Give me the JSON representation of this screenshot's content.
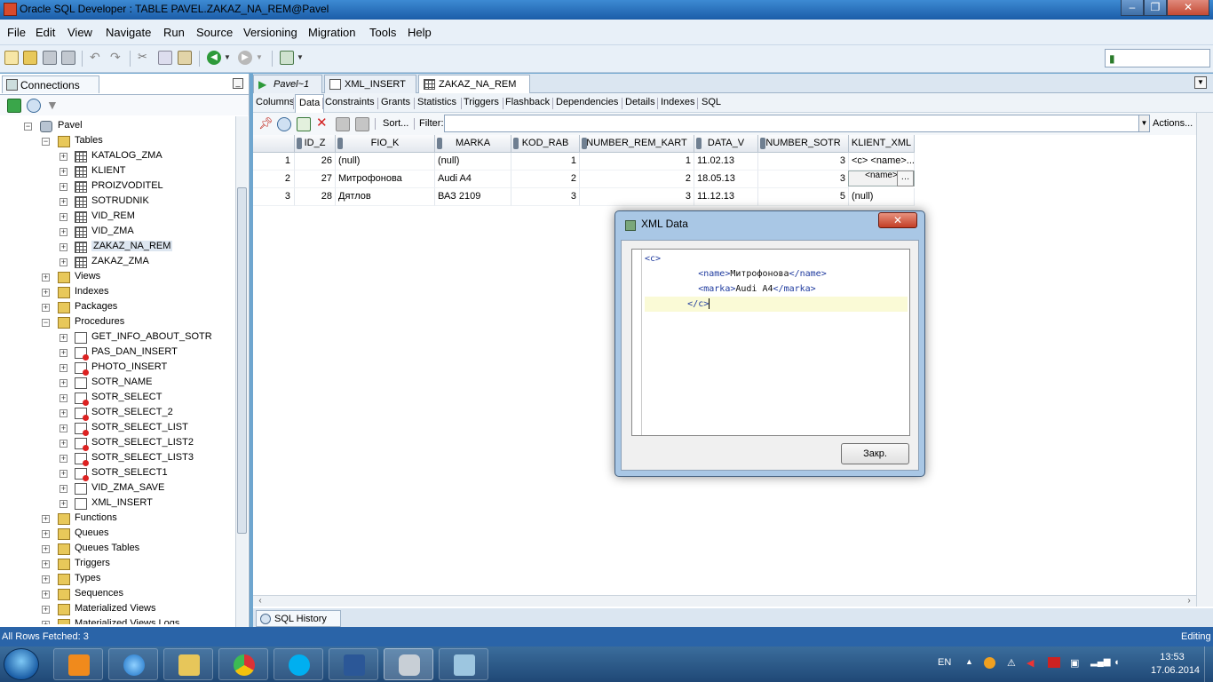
{
  "window": {
    "title": "Oracle SQL Developer : TABLE PAVEL.ZAKAZ_NA_REM@Pavel"
  },
  "menu": [
    "File",
    "Edit",
    "View",
    "Navigate",
    "Run",
    "Source",
    "Versioning",
    "Migration",
    "Tools",
    "Help"
  ],
  "connections_panel": {
    "tab_label": "Connections",
    "root": "Pavel",
    "tables_label": "Tables",
    "tables": [
      "KATALOG_ZMA",
      "KLIENT",
      "PROIZVODITEL",
      "SOTRUDNIK",
      "VID_REM",
      "VID_ZMA",
      "ZAKAZ_NA_REM",
      "ZAKAZ_ZMA"
    ],
    "groups_a": [
      "Views",
      "Indexes",
      "Packages"
    ],
    "procedures_label": "Procedures",
    "procedures": [
      "GET_INFO_ABOUT_SOTR",
      "PAS_DAN_INSERT",
      "PHOTO_INSERT",
      "SOTR_NAME",
      "SOTR_SELECT",
      "SOTR_SELECT_2",
      "SOTR_SELECT_LIST",
      "SOTR_SELECT_LIST2",
      "SOTR_SELECT_LIST3",
      "SOTR_SELECT1",
      "VID_ZMA_SAVE",
      "XML_INSERT"
    ],
    "groups_b": [
      "Functions",
      "Queues",
      "Queues Tables",
      "Triggers",
      "Types",
      "Sequences",
      "Materialized Views",
      "Materialized Views Logs"
    ]
  },
  "doc_tabs": [
    "Pavel~1",
    "XML_INSERT",
    "ZAKAZ_NA_REM"
  ],
  "sub_tabs": [
    "Columns",
    "Data",
    "Constraints",
    "Grants",
    "Statistics",
    "Triggers",
    "Flashback",
    "Dependencies",
    "Details",
    "Indexes",
    "SQL"
  ],
  "grid_toolbar": {
    "sort": "Sort...",
    "filter": "Filter:",
    "actions": "Actions..."
  },
  "grid": {
    "columns": [
      "ID_Z",
      "FIO_K",
      "MARKA",
      "KOD_RAB",
      "NUMBER_REM_KART",
      "DATA_V",
      "NUMBER_SOTR",
      "KLIENT_XML"
    ],
    "rows": [
      [
        "1",
        "26",
        "(null)",
        "(null)",
        "1",
        "1",
        "11.02.13",
        "3",
        "<c>  <name>..."
      ],
      [
        "2",
        "27",
        "Митрофонова",
        "Audi A4",
        "2",
        "2",
        "18.05.13",
        "3",
        "<name>"
      ],
      [
        "3",
        "28",
        "Дятлов",
        "ВАЗ 2109",
        "3",
        "3",
        "11.12.13",
        "5",
        "(null)"
      ]
    ]
  },
  "bottom_tab": "SQL History",
  "status": {
    "left": "All Rows Fetched: 3",
    "right": "Editing"
  },
  "dialog": {
    "title": "XML Data",
    "lines": [
      {
        "indent": "",
        "open": "<c>",
        "text": "",
        "close": ""
      },
      {
        "indent": "          ",
        "open": "<name>",
        "text": "Митрофонова",
        "close": "</name>"
      },
      {
        "indent": "          ",
        "open": "<marka>",
        "text": "Audi A4",
        "close": "</marka>"
      },
      {
        "indent": "        ",
        "open": "",
        "text": "",
        "close": "</c>"
      }
    ],
    "close_button": "Закр."
  },
  "taskbar": {
    "lang": "EN",
    "time": "13:53",
    "date": "17.06.2014"
  }
}
